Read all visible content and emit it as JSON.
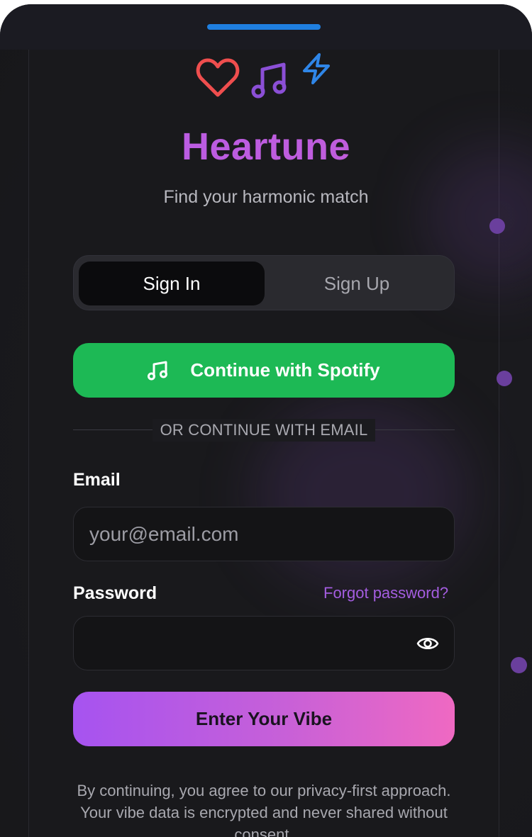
{
  "app": {
    "brand": "Heartune",
    "tagline": "Find your harmonic match"
  },
  "header_icons": [
    "heart-icon",
    "music-note-icon",
    "lightning-icon"
  ],
  "auth_tabs": {
    "active": "Sign In",
    "inactive": "Sign Up"
  },
  "spotify_button": {
    "label": "Continue with Spotify",
    "icon": "music-note-icon"
  },
  "divider": {
    "text": "OR CONTINUE WITH EMAIL"
  },
  "email": {
    "label": "Email",
    "placeholder": "your@email.com",
    "value": ""
  },
  "password": {
    "label": "Password",
    "forgot_label": "Forgot password?",
    "value": "",
    "toggle_icon": "eye-icon"
  },
  "submit": {
    "label": "Enter Your Vibe"
  },
  "legal": {
    "text": "By continuing, you agree to our privacy-first approach. Your vibe data is encrypted and never shared without consent."
  },
  "colors": {
    "background": "#19191c",
    "spotify_green": "#1db955",
    "accent_purple": "#b65ae8",
    "accent_pink": "#ef69c2",
    "handle_blue": "#1f7fe0",
    "heart_red": "#ef4e4e"
  }
}
